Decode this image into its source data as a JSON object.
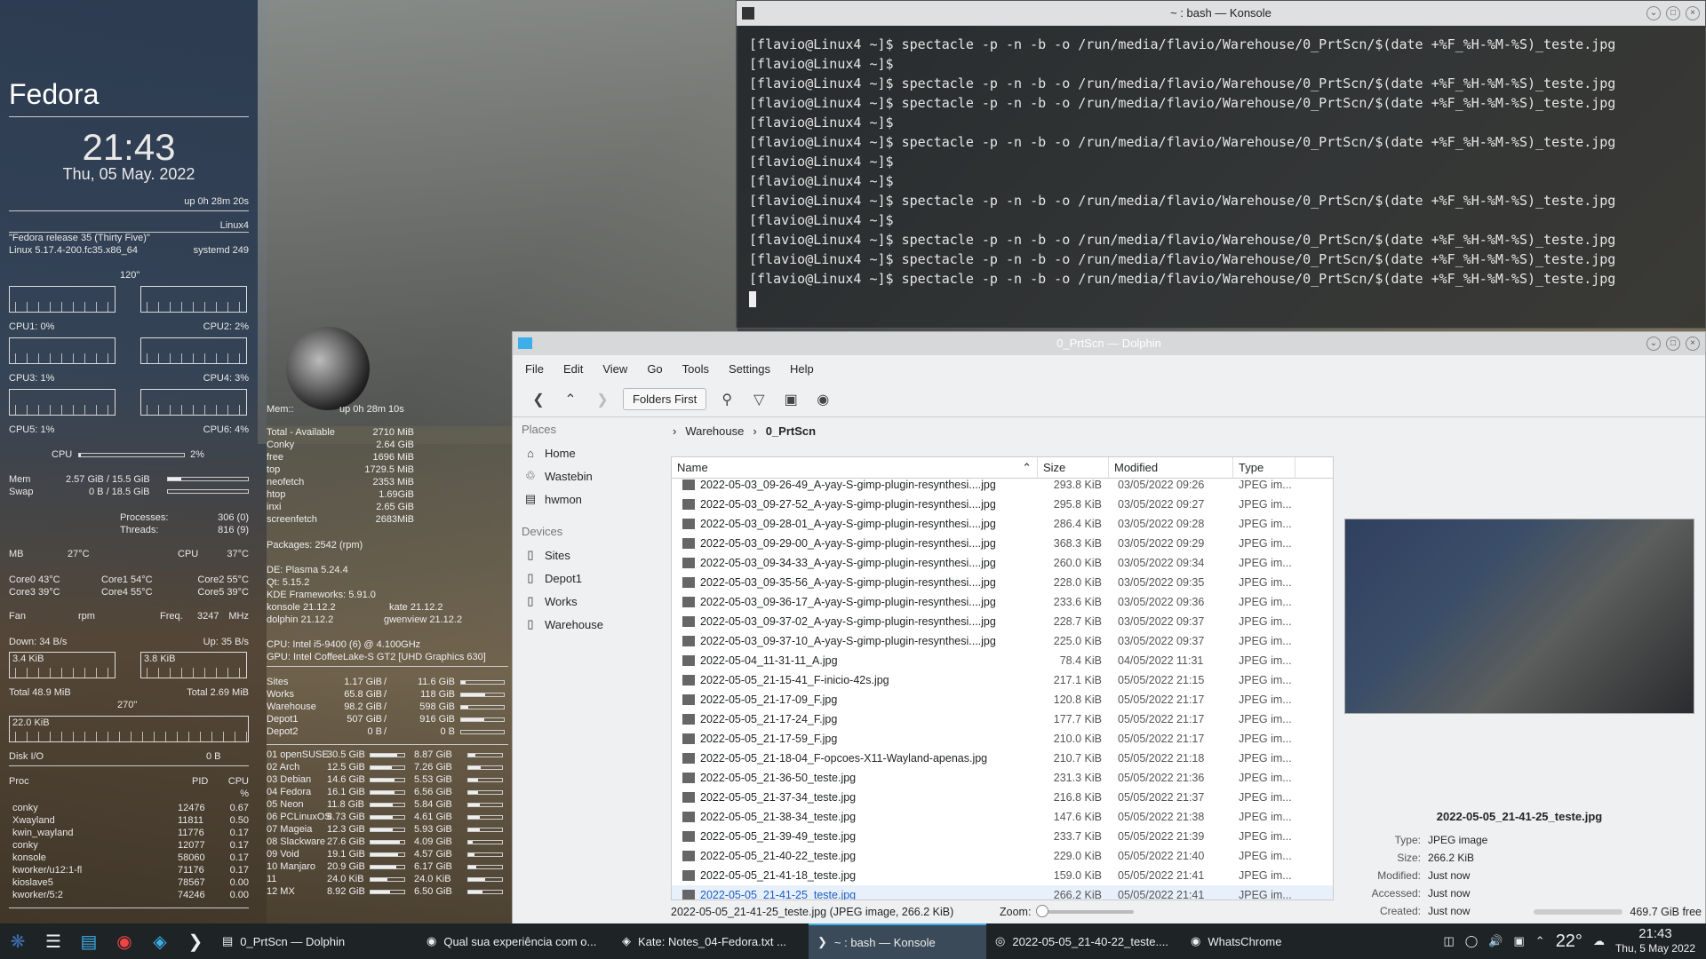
{
  "conky_left": {
    "os_name": "Fedora",
    "time": "21:43",
    "date": "Thu, 05 May. 2022",
    "uptime": "up  0h 28m 20s",
    "hostname": "Linux4",
    "release": "\"Fedora release 35 (Thirty Five)\"",
    "kernel": "Linux 5.17.4-200.fc35.x86_64",
    "systemd": "systemd 249",
    "interval": "120\"",
    "cpus": [
      {
        "label": "CPU1: 0%"
      },
      {
        "label": "CPU2: 2%"
      },
      {
        "label": "CPU3: 1%"
      },
      {
        "label": "CPU4: 3%"
      },
      {
        "label": "CPU5: 1%"
      },
      {
        "label": "CPU6: 4%"
      }
    ],
    "cpu_total_label": "CPU",
    "cpu_total": "2%",
    "cpu_total_fill": 0.02,
    "mem_label": "Mem",
    "mem": "2.57 GiB / 15.5 GiB",
    "mem_fill": 0.17,
    "swap_label": "Swap",
    "swap": "0 B / 18.5 GiB",
    "swap_fill": 0.0,
    "processes_label": "Processes:",
    "processes": "306 (0)",
    "threads_label": "Threads:",
    "threads": "816 (9)",
    "mb_label": "MB",
    "mb_temp": "27°C",
    "cpu_temp_label": "CPU",
    "cpu_temp": "37°C",
    "cores": [
      "Core0  43°C",
      "Core1  54°C",
      "Core2  55°C",
      "Core3  39°C",
      "Core4  55°C",
      "Core5  39°C"
    ],
    "fan_label": "Fan",
    "fan_unit": "rpm",
    "freq_label": "Freq.",
    "freq": "3247",
    "freq_unit": "MHz",
    "down": "Down: 34 B/s",
    "up": "Up: 35 B/s",
    "down_graph": "3.4 KiB",
    "up_graph": "3.8 KiB",
    "total_down": "Total 48.9 MiB",
    "total_up": "Total 2.69 MiB",
    "interval2": "270\"",
    "disk_graph": "22.0 KiB",
    "disk_io_label": "Disk I/O",
    "disk_io": "0 B",
    "proc_header": {
      "proc": "Proc",
      "pid": "PID",
      "cpu": "CPU",
      "pct": "%"
    },
    "procs": [
      {
        "name": "conky",
        "pid": "12476",
        "cpu": "0.67"
      },
      {
        "name": "Xwayland",
        "pid": "11811",
        "cpu": "0.50"
      },
      {
        "name": "kwin_wayland",
        "pid": "11776",
        "cpu": "0.17"
      },
      {
        "name": "conky",
        "pid": "12077",
        "cpu": "0.17"
      },
      {
        "name": "konsole",
        "pid": "58060",
        "cpu": "0.17"
      },
      {
        "name": "kworker/u12:1-fl",
        "pid": "71176",
        "cpu": "0.17"
      },
      {
        "name": "kioslave5",
        "pid": "78567",
        "cpu": "0.00"
      },
      {
        "name": "kworker/5:2",
        "pid": "74246",
        "cpu": "0.00"
      }
    ]
  },
  "conky_mid": {
    "mem_label": "Mem::",
    "uptime": "up  0h 28m 10s",
    "mem_rows": [
      {
        "k": "Total - Available",
        "v": "2710 MiB"
      },
      {
        "k": "Conky",
        "v": "2.64 GiB"
      },
      {
        "k": "free",
        "v": "1696   MiB"
      },
      {
        "k": "top",
        "v": "1729.5  MiB"
      },
      {
        "k": "neofetch",
        "v": "2353 MiB"
      },
      {
        "k": "htop",
        "v": "1.69GiB"
      },
      {
        "k": "inxi",
        "v": "2.65 GiB"
      },
      {
        "k": "screenfetch",
        "v": "2683MiB"
      }
    ],
    "packages": "Packages: 2542 (rpm)",
    "de": "DE: Plasma 5.24.4",
    "qt": "Qt: 5.15.2",
    "kf": "KDE Frameworks: 5.91.0",
    "konsole": "konsole 21.12.2",
    "kate": "kate 21.12.2",
    "dolphin": "dolphin 21.12.2",
    "gwenview": "gwenview 21.12.2",
    "cpu": "CPU: Intel i5-9400 (6) @ 4.100GHz",
    "gpu": "GPU: Intel CoffeeLake-S GT2 [UHD Graphics 630]",
    "disks": [
      {
        "name": "Sites",
        "used": "1.17 GiB",
        "total": "11.6 GiB",
        "fill": 0.1
      },
      {
        "name": "Works",
        "used": "65.8 GiB",
        "total": "118 GiB",
        "fill": 0.56
      },
      {
        "name": "Warehouse",
        "used": "98.2 GiB",
        "total": "598 GiB",
        "fill": 0.16
      },
      {
        "name": "Depot1",
        "used": "507 GiB",
        "total": "916 GiB",
        "fill": 0.55
      },
      {
        "name": "Depot2",
        "used": "0 B",
        "total": "0 B",
        "fill": 0.0
      }
    ],
    "parts": [
      {
        "name": "01 openSUSE",
        "a": "30.5 GiB",
        "b": "8.87 GiB",
        "fa": 0.78,
        "fb": 0.22
      },
      {
        "name": "02 Arch",
        "a": "12.5 GiB",
        "b": "7.26 GiB",
        "fa": 0.63,
        "fb": 0.37
      },
      {
        "name": "03 Debian",
        "a": "14.6 GiB",
        "b": "5.53 GiB",
        "fa": 0.72,
        "fb": 0.28
      },
      {
        "name": "04 Fedora",
        "a": "16.1 GiB",
        "b": "6.56 GiB",
        "fa": 0.71,
        "fb": 0.29
      },
      {
        "name": "05 Neon",
        "a": "11.8 GiB",
        "b": "5.84 GiB",
        "fa": 0.67,
        "fb": 0.33
      },
      {
        "name": "06 PCLinuxOS",
        "a": "8.73 GiB",
        "b": "4.61 GiB",
        "fa": 0.65,
        "fb": 0.35
      },
      {
        "name": "07 Mageia",
        "a": "12.3 GiB",
        "b": "5.93 GiB",
        "fa": 0.67,
        "fb": 0.33
      },
      {
        "name": "08 Slackware",
        "a": "27.6 GiB",
        "b": "4.09 GiB",
        "fa": 0.87,
        "fb": 0.13
      },
      {
        "name": "09 Void",
        "a": "19.1 GiB",
        "b": "4.57 GiB",
        "fa": 0.81,
        "fb": 0.19
      },
      {
        "name": "10 Manjaro",
        "a": "20.9 GiB",
        "b": "6.17 GiB",
        "fa": 0.77,
        "fb": 0.23
      },
      {
        "name": "11",
        "a": "24.0 KiB",
        "b": "24.0 KiB",
        "fa": 0.5,
        "fb": 0.5
      },
      {
        "name": "12 MX",
        "a": "8.92 GiB",
        "b": "6.50 GiB",
        "fa": 0.58,
        "fb": 0.42
      }
    ]
  },
  "konsole": {
    "title": "~ : bash — Konsole",
    "lines": [
      "[flavio@Linux4 ~]$ spectacle -p -n -b -o /run/media/flavio/Warehouse/0_PrtScn/$(date +%F_%H-%M-%S)_teste.jpg",
      "[flavio@Linux4 ~]$",
      "[flavio@Linux4 ~]$ spectacle -p -n -b -o /run/media/flavio/Warehouse/0_PrtScn/$(date +%F_%H-%M-%S)_teste.jpg",
      "[flavio@Linux4 ~]$ spectacle -p -n -b -o /run/media/flavio/Warehouse/0_PrtScn/$(date +%F_%H-%M-%S)_teste.jpg",
      "[flavio@Linux4 ~]$",
      "[flavio@Linux4 ~]$ spectacle -p -n -b -o /run/media/flavio/Warehouse/0_PrtScn/$(date +%F_%H-%M-%S)_teste.jpg",
      "[flavio@Linux4 ~]$",
      "[flavio@Linux4 ~]$",
      "[flavio@Linux4 ~]$ spectacle -p -n -b -o /run/media/flavio/Warehouse/0_PrtScn/$(date +%F_%H-%M-%S)_teste.jpg",
      "[flavio@Linux4 ~]$",
      "[flavio@Linux4 ~]$ spectacle -p -n -b -o /run/media/flavio/Warehouse/0_PrtScn/$(date +%F_%H-%M-%S)_teste.jpg",
      "[flavio@Linux4 ~]$ spectacle -p -n -b -o /run/media/flavio/Warehouse/0_PrtScn/$(date +%F_%H-%M-%S)_teste.jpg",
      "[flavio@Linux4 ~]$ spectacle -p -n -b -o /run/media/flavio/Warehouse/0_PrtScn/$(date +%F_%H-%M-%S)_teste.jpg"
    ]
  },
  "dolphin": {
    "title": "0_PrtScn — Dolphin",
    "menu": [
      "File",
      "Edit",
      "View",
      "Go",
      "Tools",
      "Settings",
      "Help"
    ],
    "folders_first": "Folders First",
    "places_header": "Places",
    "places": [
      {
        "label": "Home",
        "icon": "home-icon"
      },
      {
        "label": "Wastebin",
        "icon": "trash-icon"
      },
      {
        "label": "hwmon",
        "icon": "folder-icon"
      }
    ],
    "devices_header": "Devices",
    "devices": [
      {
        "label": "Sites"
      },
      {
        "label": "Depot1"
      },
      {
        "label": "Works"
      },
      {
        "label": "Warehouse"
      }
    ],
    "breadcrumb": [
      "Warehouse",
      "0_PrtScn"
    ],
    "columns": {
      "name": "Name",
      "size": "Size",
      "modified": "Modified",
      "type": "Type"
    },
    "files": [
      {
        "name": "2022-05-03_09-26-49_A-yay-S-gimp-plugin-resynthesi....jpg",
        "size": "293.8 KiB",
        "modified": "03/05/2022 09:26",
        "type": "JPEG im..."
      },
      {
        "name": "2022-05-03_09-27-52_A-yay-S-gimp-plugin-resynthesi....jpg",
        "size": "295.8 KiB",
        "modified": "03/05/2022 09:27",
        "type": "JPEG im..."
      },
      {
        "name": "2022-05-03_09-28-01_A-yay-S-gimp-plugin-resynthesi....jpg",
        "size": "286.4 KiB",
        "modified": "03/05/2022 09:28",
        "type": "JPEG im..."
      },
      {
        "name": "2022-05-03_09-29-00_A-yay-S-gimp-plugin-resynthesi....jpg",
        "size": "368.3 KiB",
        "modified": "03/05/2022 09:29",
        "type": "JPEG im..."
      },
      {
        "name": "2022-05-03_09-34-33_A-yay-S-gimp-plugin-resynthesi....jpg",
        "size": "260.0 KiB",
        "modified": "03/05/2022 09:34",
        "type": "JPEG im..."
      },
      {
        "name": "2022-05-03_09-35-56_A-yay-S-gimp-plugin-resynthesi....jpg",
        "size": "228.0 KiB",
        "modified": "03/05/2022 09:35",
        "type": "JPEG im..."
      },
      {
        "name": "2022-05-03_09-36-17_A-yay-S-gimp-plugin-resynthesi....jpg",
        "size": "233.6 KiB",
        "modified": "03/05/2022 09:36",
        "type": "JPEG im..."
      },
      {
        "name": "2022-05-03_09-37-02_A-yay-S-gimp-plugin-resynthesi....jpg",
        "size": "228.7 KiB",
        "modified": "03/05/2022 09:37",
        "type": "JPEG im..."
      },
      {
        "name": "2022-05-03_09-37-10_A-yay-S-gimp-plugin-resynthesi....jpg",
        "size": "225.0 KiB",
        "modified": "03/05/2022 09:37",
        "type": "JPEG im..."
      },
      {
        "name": "2022-05-04_11-31-11_A.jpg",
        "size": "78.4 KiB",
        "modified": "04/05/2022 11:31",
        "type": "JPEG im..."
      },
      {
        "name": "2022-05-05_21-15-41_F-inicio-42s.jpg",
        "size": "217.1 KiB",
        "modified": "05/05/2022 21:15",
        "type": "JPEG im..."
      },
      {
        "name": "2022-05-05_21-17-09_F.jpg",
        "size": "120.8 KiB",
        "modified": "05/05/2022 21:17",
        "type": "JPEG im..."
      },
      {
        "name": "2022-05-05_21-17-24_F.jpg",
        "size": "177.7 KiB",
        "modified": "05/05/2022 21:17",
        "type": "JPEG im..."
      },
      {
        "name": "2022-05-05_21-17-59_F.jpg",
        "size": "210.0 KiB",
        "modified": "05/05/2022 21:17",
        "type": "JPEG im..."
      },
      {
        "name": "2022-05-05_21-18-04_F-opcoes-X11-Wayland-apenas.jpg",
        "size": "210.7 KiB",
        "modified": "05/05/2022 21:18",
        "type": "JPEG im..."
      },
      {
        "name": "2022-05-05_21-36-50_teste.jpg",
        "size": "231.3 KiB",
        "modified": "05/05/2022 21:36",
        "type": "JPEG im..."
      },
      {
        "name": "2022-05-05_21-37-34_teste.jpg",
        "size": "216.8 KiB",
        "modified": "05/05/2022 21:37",
        "type": "JPEG im..."
      },
      {
        "name": "2022-05-05_21-38-34_teste.jpg",
        "size": "147.6 KiB",
        "modified": "05/05/2022 21:38",
        "type": "JPEG im..."
      },
      {
        "name": "2022-05-05_21-39-49_teste.jpg",
        "size": "233.7 KiB",
        "modified": "05/05/2022 21:39",
        "type": "JPEG im..."
      },
      {
        "name": "2022-05-05_21-40-22_teste.jpg",
        "size": "229.0 KiB",
        "modified": "05/05/2022 21:40",
        "type": "JPEG im..."
      },
      {
        "name": "2022-05-05_21-41-18_teste.jpg",
        "size": "159.0 KiB",
        "modified": "05/05/2022 21:41",
        "type": "JPEG im..."
      },
      {
        "name": "2022-05-05_21-41-25_teste.jpg",
        "size": "266.2 KiB",
        "modified": "05/05/2022 21:41",
        "type": "JPEG im...",
        "selected": true
      }
    ],
    "preview": {
      "name": "2022-05-05_21-41-25_teste.jpg",
      "info": [
        {
          "k": "Type:",
          "v": "JPEG image"
        },
        {
          "k": "Size:",
          "v": "266.2 KiB"
        },
        {
          "k": "Modified:",
          "v": "Just now"
        },
        {
          "k": "Accessed:",
          "v": "Just now"
        },
        {
          "k": "Created:",
          "v": "Just now"
        }
      ]
    },
    "status_text": "2022-05-05_21-41-25_teste.jpg (JPEG image, 266.2 KiB)",
    "zoom_label": "Zoom:",
    "free_space": "469.7 GiB free"
  },
  "taskbar": {
    "tasks": [
      {
        "label": "0_PrtScn — Dolphin",
        "icon": "folder-icon"
      },
      {
        "label": "Qual sua experiência com o...",
        "icon": "chrome-icon"
      },
      {
        "label": "Kate: Notes_04-Fedora.txt ...",
        "icon": "kate-icon"
      },
      {
        "label": "~ : bash — Konsole",
        "icon": "terminal-icon",
        "active": true
      },
      {
        "label": "2022-05-05_21-40-22_teste....",
        "icon": "image-icon"
      },
      {
        "label": "WhatsChrome",
        "icon": "chrome-icon"
      }
    ],
    "temperature": "22°",
    "clock_time": "21:43",
    "clock_date": "Thu, 5 May 2022"
  }
}
